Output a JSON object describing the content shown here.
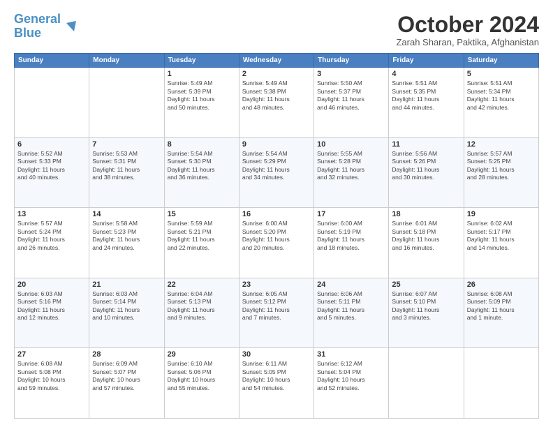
{
  "header": {
    "logo_line1": "General",
    "logo_line2": "Blue",
    "month": "October 2024",
    "location": "Zarah Sharan, Paktika, Afghanistan"
  },
  "weekdays": [
    "Sunday",
    "Monday",
    "Tuesday",
    "Wednesday",
    "Thursday",
    "Friday",
    "Saturday"
  ],
  "rows": [
    [
      {
        "day": "",
        "detail": ""
      },
      {
        "day": "",
        "detail": ""
      },
      {
        "day": "1",
        "detail": "Sunrise: 5:49 AM\nSunset: 5:39 PM\nDaylight: 11 hours\nand 50 minutes."
      },
      {
        "day": "2",
        "detail": "Sunrise: 5:49 AM\nSunset: 5:38 PM\nDaylight: 11 hours\nand 48 minutes."
      },
      {
        "day": "3",
        "detail": "Sunrise: 5:50 AM\nSunset: 5:37 PM\nDaylight: 11 hours\nand 46 minutes."
      },
      {
        "day": "4",
        "detail": "Sunrise: 5:51 AM\nSunset: 5:35 PM\nDaylight: 11 hours\nand 44 minutes."
      },
      {
        "day": "5",
        "detail": "Sunrise: 5:51 AM\nSunset: 5:34 PM\nDaylight: 11 hours\nand 42 minutes."
      }
    ],
    [
      {
        "day": "6",
        "detail": "Sunrise: 5:52 AM\nSunset: 5:33 PM\nDaylight: 11 hours\nand 40 minutes."
      },
      {
        "day": "7",
        "detail": "Sunrise: 5:53 AM\nSunset: 5:31 PM\nDaylight: 11 hours\nand 38 minutes."
      },
      {
        "day": "8",
        "detail": "Sunrise: 5:54 AM\nSunset: 5:30 PM\nDaylight: 11 hours\nand 36 minutes."
      },
      {
        "day": "9",
        "detail": "Sunrise: 5:54 AM\nSunset: 5:29 PM\nDaylight: 11 hours\nand 34 minutes."
      },
      {
        "day": "10",
        "detail": "Sunrise: 5:55 AM\nSunset: 5:28 PM\nDaylight: 11 hours\nand 32 minutes."
      },
      {
        "day": "11",
        "detail": "Sunrise: 5:56 AM\nSunset: 5:26 PM\nDaylight: 11 hours\nand 30 minutes."
      },
      {
        "day": "12",
        "detail": "Sunrise: 5:57 AM\nSunset: 5:25 PM\nDaylight: 11 hours\nand 28 minutes."
      }
    ],
    [
      {
        "day": "13",
        "detail": "Sunrise: 5:57 AM\nSunset: 5:24 PM\nDaylight: 11 hours\nand 26 minutes."
      },
      {
        "day": "14",
        "detail": "Sunrise: 5:58 AM\nSunset: 5:23 PM\nDaylight: 11 hours\nand 24 minutes."
      },
      {
        "day": "15",
        "detail": "Sunrise: 5:59 AM\nSunset: 5:21 PM\nDaylight: 11 hours\nand 22 minutes."
      },
      {
        "day": "16",
        "detail": "Sunrise: 6:00 AM\nSunset: 5:20 PM\nDaylight: 11 hours\nand 20 minutes."
      },
      {
        "day": "17",
        "detail": "Sunrise: 6:00 AM\nSunset: 5:19 PM\nDaylight: 11 hours\nand 18 minutes."
      },
      {
        "day": "18",
        "detail": "Sunrise: 6:01 AM\nSunset: 5:18 PM\nDaylight: 11 hours\nand 16 minutes."
      },
      {
        "day": "19",
        "detail": "Sunrise: 6:02 AM\nSunset: 5:17 PM\nDaylight: 11 hours\nand 14 minutes."
      }
    ],
    [
      {
        "day": "20",
        "detail": "Sunrise: 6:03 AM\nSunset: 5:16 PM\nDaylight: 11 hours\nand 12 minutes."
      },
      {
        "day": "21",
        "detail": "Sunrise: 6:03 AM\nSunset: 5:14 PM\nDaylight: 11 hours\nand 10 minutes."
      },
      {
        "day": "22",
        "detail": "Sunrise: 6:04 AM\nSunset: 5:13 PM\nDaylight: 11 hours\nand 9 minutes."
      },
      {
        "day": "23",
        "detail": "Sunrise: 6:05 AM\nSunset: 5:12 PM\nDaylight: 11 hours\nand 7 minutes."
      },
      {
        "day": "24",
        "detail": "Sunrise: 6:06 AM\nSunset: 5:11 PM\nDaylight: 11 hours\nand 5 minutes."
      },
      {
        "day": "25",
        "detail": "Sunrise: 6:07 AM\nSunset: 5:10 PM\nDaylight: 11 hours\nand 3 minutes."
      },
      {
        "day": "26",
        "detail": "Sunrise: 6:08 AM\nSunset: 5:09 PM\nDaylight: 11 hours\nand 1 minute."
      }
    ],
    [
      {
        "day": "27",
        "detail": "Sunrise: 6:08 AM\nSunset: 5:08 PM\nDaylight: 10 hours\nand 59 minutes."
      },
      {
        "day": "28",
        "detail": "Sunrise: 6:09 AM\nSunset: 5:07 PM\nDaylight: 10 hours\nand 57 minutes."
      },
      {
        "day": "29",
        "detail": "Sunrise: 6:10 AM\nSunset: 5:06 PM\nDaylight: 10 hours\nand 55 minutes."
      },
      {
        "day": "30",
        "detail": "Sunrise: 6:11 AM\nSunset: 5:05 PM\nDaylight: 10 hours\nand 54 minutes."
      },
      {
        "day": "31",
        "detail": "Sunrise: 6:12 AM\nSunset: 5:04 PM\nDaylight: 10 hours\nand 52 minutes."
      },
      {
        "day": "",
        "detail": ""
      },
      {
        "day": "",
        "detail": ""
      }
    ]
  ]
}
